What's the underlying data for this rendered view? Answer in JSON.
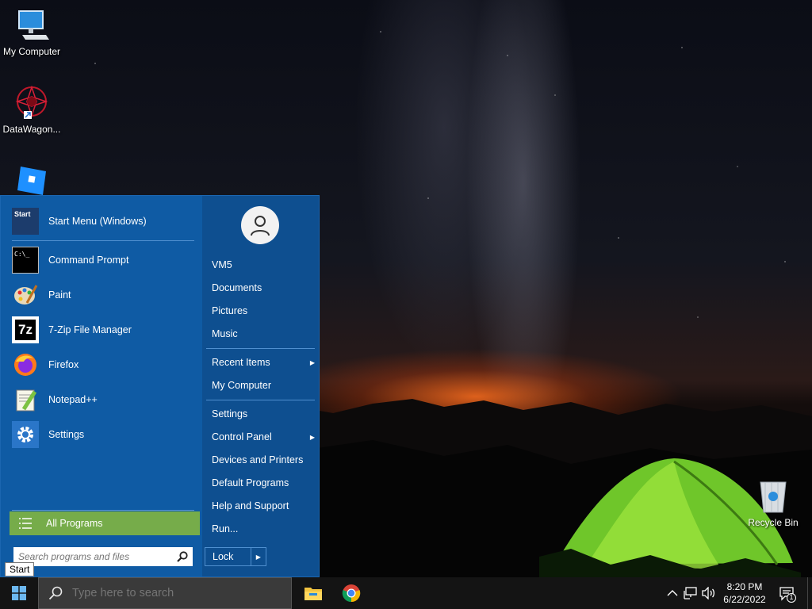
{
  "desktop": {
    "icons": [
      {
        "label": "My Computer",
        "icon": "monitor-icon"
      },
      {
        "label": "DataWagon...",
        "icon": "datawagon-icon"
      },
      {
        "label": "",
        "icon": "roblox-icon"
      },
      {
        "label": "Recycle Bin",
        "icon": "recycle-bin-icon"
      }
    ]
  },
  "start_menu": {
    "pinned": [
      {
        "label": "Start Menu (Windows)",
        "icon": "start-menu-app-icon",
        "icon_text": "Start"
      },
      {
        "label": "Command Prompt",
        "icon": "command-prompt-icon",
        "icon_text": "C:\\_"
      },
      {
        "label": "Paint",
        "icon": "paint-palette-icon"
      },
      {
        "label": "7-Zip File Manager",
        "icon": "7zip-icon",
        "icon_text": "7z"
      },
      {
        "label": "Firefox",
        "icon": "firefox-icon"
      },
      {
        "label": "Notepad++",
        "icon": "notepad-plus-plus-icon"
      },
      {
        "label": "Settings",
        "icon": "gear-icon"
      }
    ],
    "all_programs_label": "All Programs",
    "search_placeholder": "Search programs and files",
    "right": {
      "user_icon": "user-icon",
      "items_group1": [
        "VM5",
        "Documents",
        "Pictures",
        "Music"
      ],
      "recent_items": "Recent Items",
      "my_computer": "My Computer",
      "items_group3": [
        "Settings"
      ],
      "control_panel": "Control Panel",
      "items_group4": [
        "Devices and Printers",
        "Default Programs",
        "Help and Support",
        "Run..."
      ],
      "lock_label": "Lock"
    }
  },
  "tooltip": "Start",
  "taskbar": {
    "search_placeholder": "Type here to search",
    "apps": [
      {
        "name": "File Explorer",
        "icon": "folder-icon"
      },
      {
        "name": "Google Chrome",
        "icon": "chrome-icon"
      }
    ],
    "tray": {
      "time": "8:20 PM",
      "date": "6/22/2022",
      "notification_count": "1"
    }
  },
  "colors": {
    "start_menu_left": "#0f5ba4",
    "start_menu_right": "#0e4f90",
    "all_programs": "#76ac4a",
    "taskbar": "#141414"
  }
}
